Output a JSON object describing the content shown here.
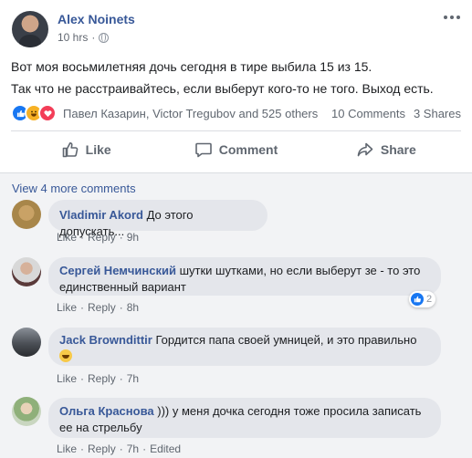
{
  "post": {
    "author": "Alex Noinets",
    "time": "10 hrs",
    "separator": "·",
    "lines": [
      "Вот моя восьмилетняя дочь сегодня в тире выбила 15 из 15.",
      "Так что не расстраивайтесь, если выберут кого-то не того. Выход есть."
    ]
  },
  "reactions": {
    "names": "Павел Казарин, Victor Tregubov and 525 others",
    "comments_count": "10 Comments",
    "shares_count": "3 Shares",
    "icons": [
      "like-icon",
      "haha-icon",
      "love-icon"
    ]
  },
  "actions": {
    "like": "Like",
    "comment": "Comment",
    "share": "Share"
  },
  "comments_section": {
    "view_more": "View 4 more comments",
    "comments": [
      {
        "name": "Vladimir Akord",
        "text": "До этого допускать...",
        "like": "Like",
        "reply": "Reply",
        "time": "9h",
        "edited": ""
      },
      {
        "name": "Сергей Немчинский",
        "text_line1": "шутки шутками, но если выберут зе - то это",
        "text_line2": "единственный вариант",
        "like": "Like",
        "reply": "Reply",
        "time": "8h",
        "reaction_count": "2"
      },
      {
        "name": "Jack Browndittir",
        "text": "Гордится папа своей умницей, и это правильно",
        "like": "Like",
        "reply": "Reply",
        "time": "7h"
      },
      {
        "name": "Ольга Краснова",
        "text_line1": "))) у меня дочка сегодня тоже просила записать",
        "text_line2": "ее на стрельбу",
        "like": "Like",
        "reply": "Reply",
        "time": "7h",
        "edited": "Edited"
      }
    ]
  },
  "colors": {
    "link": "#385898",
    "secondary_text": "#606770",
    "bubble": "#e4e6eb",
    "comments_bg": "#f2f3f5",
    "like_blue": "#1877f2"
  }
}
